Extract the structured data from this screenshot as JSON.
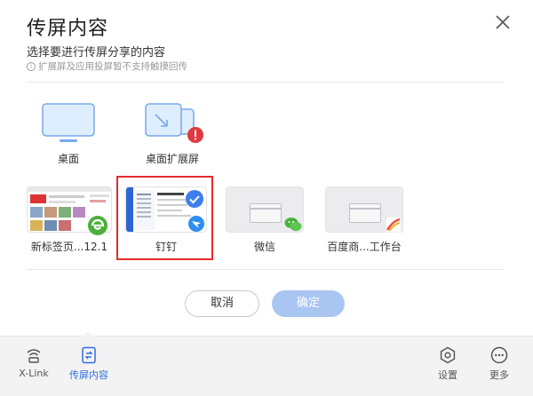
{
  "dialog": {
    "title": "传屏内容",
    "subtitle": "选择要进行传屏分享的内容",
    "hint": "扩展屏及应用投屏暂不支持触摸回传"
  },
  "screens": [
    {
      "label": "桌面"
    },
    {
      "label": "桌面扩展屏"
    }
  ],
  "apps": [
    {
      "label": "新标签页...12.1"
    },
    {
      "label": "钉钉",
      "selected": true
    },
    {
      "label": "微信"
    },
    {
      "label": "百度商...工作台"
    }
  ],
  "buttons": {
    "cancel": "取消",
    "ok": "确定"
  },
  "bottombar": {
    "xlink": "X-Link",
    "cast": "传屏内容",
    "settings": "设置",
    "more": "更多"
  },
  "colors": {
    "accent": "#2f6fe0",
    "selected_border": "#e52b2b",
    "ok_button": "#a9c6f2",
    "warning": "#e0383e"
  }
}
